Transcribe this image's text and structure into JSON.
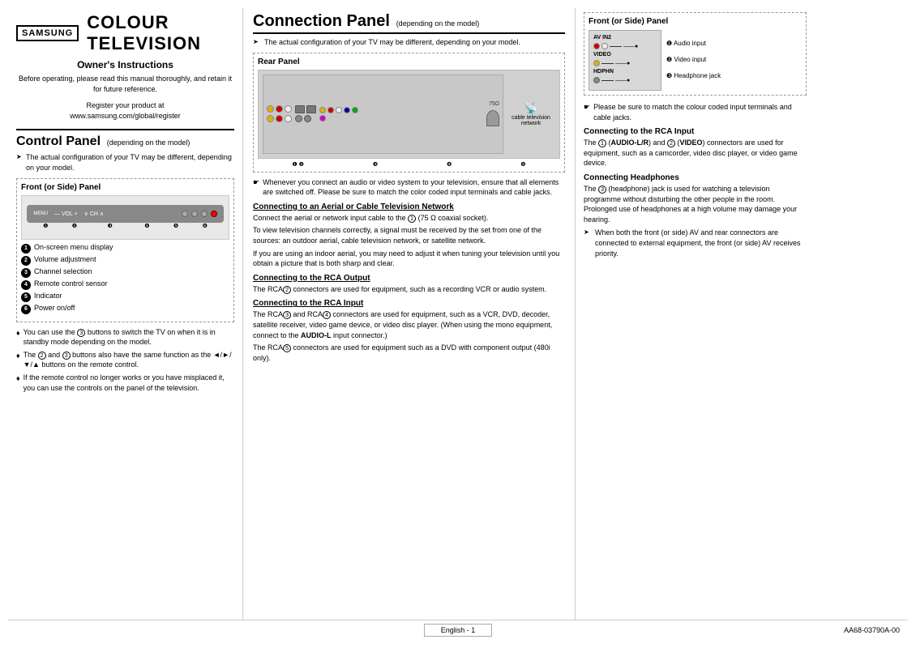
{
  "brand": {
    "name": "SAMSUNG",
    "title": "COLOUR TELEVISION"
  },
  "left": {
    "owners_title": "Owner's Instructions",
    "owners_para": "Before operating, please read this manual thoroughly, and retain it for future reference.",
    "register_text": "Register your product at\nwww.samsung.com/global/register",
    "control_panel_title": "Control Panel",
    "control_panel_sub": "(depending on the model)",
    "control_note": "The actual configuration of your TV may be different, depending on your model.",
    "front_panel_title": "Front (or Side) Panel",
    "numbered_items": [
      {
        "num": "1",
        "text": "On-screen menu display"
      },
      {
        "num": "2",
        "text": "Volume adjustment"
      },
      {
        "num": "3",
        "text": "Channel selection"
      },
      {
        "num": "4",
        "text": "Remote control sensor"
      },
      {
        "num": "5",
        "text": "Indicator"
      },
      {
        "num": "6",
        "text": "Power on/off"
      }
    ],
    "bullets": [
      "You can use the ❸ buttons to switch the TV on when it is in standby mode depending on the model.",
      "The ❷ and ❸ buttons also have the same function as the ◄/►/▼/▲ buttons on the remote control.",
      "If the remote control no longer works or you have misplaced it, you can use the controls on the panel of the television."
    ]
  },
  "middle": {
    "connection_panel_title": "Connection Panel",
    "connection_panel_sub": "(depending on the model)",
    "cp_note": "The actual configuration of your TV may be different, depending on your model.",
    "rear_panel_title": "Rear Panel",
    "warning_text": "Whenever you connect an audio or video system to your television, ensure that all elements are switched off. Please be sure to match the color coded input terminals and cable jacks.",
    "sections": [
      {
        "title": "Connecting to an Aerial or Cable Television Network",
        "paras": [
          "Connect the aerial or network input cable to the ❶ (75 Ω coaxial socket).",
          "To view television channels correctly, a signal must be received by the set from one of the sources: an outdoor aerial, cable television network, or satellite network.",
          "If you are using an indoor aerial, you may need to adjust it when tuning your television until you obtain a picture that is both sharp and clear."
        ]
      },
      {
        "title": "Connecting to the RCA Output",
        "paras": [
          "The RCA❷ connectors are used for equipment, such as a recording VCR or audio system."
        ]
      },
      {
        "title": "Connecting to the RCA Input",
        "paras": [
          "The RCA❸ and RCA❹ connectors are used for equipment, such as a VCR, DVD, decoder, satellite receiver, video game device, or video disc player. (When using the mono equipment, connect to the AUDIO-L input connector.)",
          "The RCA❺ connectors are used for equipment such as a DVD with component output (480i only)."
        ]
      }
    ],
    "cable_tv_label": "cable television\nnetwork"
  },
  "right": {
    "front_panel_title": "Front (or Side) Panel",
    "fp_inputs": [
      {
        "label": "AV IN2",
        "conn_label": "❶ Audio input"
      },
      {
        "label": "VIDEO",
        "conn_label": "❷ Video input"
      },
      {
        "label": "HDPHN",
        "conn_label": "❸ Headphone jack"
      }
    ],
    "color_note": "Please be sure to match the colour coded input terminals and cable jacks.",
    "rca_input_title": "Connecting to the RCA Input",
    "rca_input_text": "The ❶ (AUDIO-L/R) and ❷ (VIDEO) connectors are used for equipment, such as a camcorder, video disc player, or video game device.",
    "headphones_title": "Connecting Headphones",
    "headphones_text": "The ❸ (headphone) jack is used for watching a television programme without disturbing the other people in the room. Prolonged use of headphones at a high volume may damage your hearing.",
    "av_note": "When both the front (or side) AV and rear connectors are connected to external equipment, the front (or side) AV receives priority."
  },
  "footer": {
    "page_label": "English - 1",
    "model_code": "AA68-03790A-00"
  }
}
